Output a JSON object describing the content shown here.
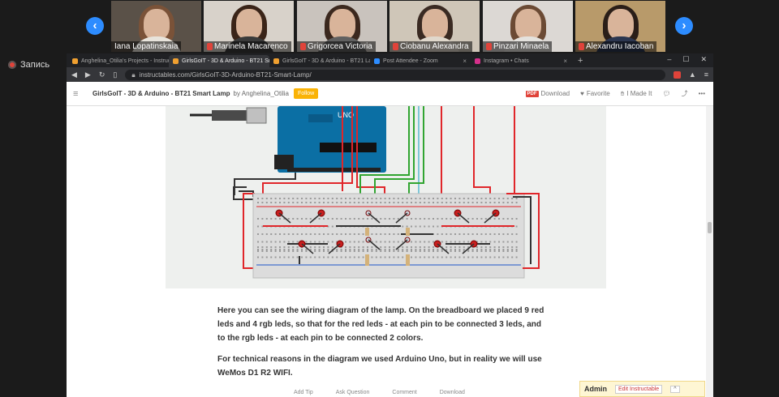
{
  "participants": [
    {
      "name": "Iana Lopatinskaia",
      "muted": false,
      "bg": "#5a5148",
      "hair": "#7a5238",
      "shirt": "#e8e4dc"
    },
    {
      "name": "Marinela Macarenco",
      "muted": true,
      "bg": "#d8d2ca",
      "hair": "#3a2418",
      "shirt": "#3a3a3a"
    },
    {
      "name": "Grigorcea Victoria",
      "muted": true,
      "bg": "#c9c3bd",
      "hair": "#3b281e",
      "shirt": "#606060"
    },
    {
      "name": "Ciobanu Alexandra",
      "muted": true,
      "bg": "#cfc6b8",
      "hair": "#3a2a22",
      "shirt": "#e0d8cc"
    },
    {
      "name": "Pinzari Minaela",
      "muted": true,
      "bg": "#dcd8d4",
      "hair": "#6b4a34",
      "shirt": "#e4e2de"
    },
    {
      "name": "Alexandru Iacoban",
      "muted": true,
      "bg": "#b89a6a",
      "hair": "#2a1e18",
      "shirt": "#2c3650"
    }
  ],
  "recording": {
    "label": "Запись"
  },
  "tabs": [
    {
      "title": "Anghelina_Otilia's Projects - Instructab",
      "active": false,
      "color": "#f0a030"
    },
    {
      "title": "GirlsGoIT - 3D & Arduino - BT21 Sma",
      "active": true,
      "color": "#f0a030"
    },
    {
      "title": "GirlsGoIT - 3D & Arduino - BT21 Lam",
      "active": false,
      "color": "#f0a030"
    },
    {
      "title": "Post Attendee - Zoom",
      "active": false,
      "color": "#2d8cff"
    },
    {
      "title": "Instagram • Chats",
      "active": false,
      "color": "#d6308b"
    }
  ],
  "url": "instructables.com/GirlsGoIT-3D-Arduino-BT21-Smart-Lamp/",
  "header": {
    "title": "GirlsGoIT - 3D & Arduino - BT21 Smart Lamp",
    "by": "by Anghelina_Otilia",
    "follow": "Follow",
    "download": "Download",
    "favorite": "Favorite",
    "made": "I Made It"
  },
  "paragraphs": [
    "Here you can see the wiring diagram of the lamp. On the breadboard we placed 9 red leds and 4 rgb leds, so that for the red leds - at each pin to be connected 3 leds, and to the rgb leds - at each pin to be connected 2 colors.",
    "For technical reasons in the diagram we used Arduino Uno, but in reality we will use WeMos D1 R2 WIFI."
  ],
  "admin": {
    "label": "Admin",
    "edit": "Edit Instructable"
  },
  "bottom_actions": [
    "Add Tip",
    "Ask Question",
    "Comment",
    "Download"
  ],
  "colors": {
    "zoom_blue": "#2d8cff",
    "follow": "#fab306",
    "arduino": "#0b6fa4",
    "wire_red": "#e0262a",
    "wire_green": "#31a531",
    "wire_black": "#333333"
  }
}
